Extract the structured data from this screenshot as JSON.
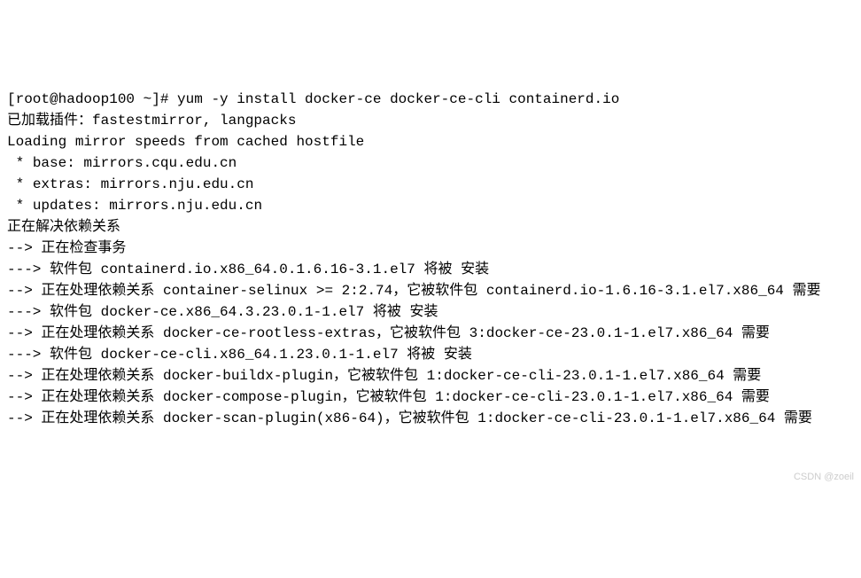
{
  "terminal": {
    "lines": [
      "[root@hadoop100 ~]# yum -y install docker-ce docker-ce-cli containerd.io",
      "已加载插件：fastestmirror, langpacks",
      "Loading mirror speeds from cached hostfile",
      " * base: mirrors.cqu.edu.cn",
      " * extras: mirrors.nju.edu.cn",
      " * updates: mirrors.nju.edu.cn",
      "正在解决依赖关系",
      "--> 正在检查事务",
      "---> 软件包 containerd.io.x86_64.0.1.6.16-3.1.el7 将被 安装",
      "--> 正在处理依赖关系 container-selinux >= 2:2.74，它被软件包 containerd.io-1.6.16-3.1.el7.x86_64 需要",
      "---> 软件包 docker-ce.x86_64.3.23.0.1-1.el7 将被 安装",
      "--> 正在处理依赖关系 docker-ce-rootless-extras，它被软件包 3:docker-ce-23.0.1-1.el7.x86_64 需要",
      "---> 软件包 docker-ce-cli.x86_64.1.23.0.1-1.el7 将被 安装",
      "--> 正在处理依赖关系 docker-buildx-plugin，它被软件包 1:docker-ce-cli-23.0.1-1.el7.x86_64 需要",
      "--> 正在处理依赖关系 docker-compose-plugin，它被软件包 1:docker-ce-cli-23.0.1-1.el7.x86_64 需要",
      "--> 正在处理依赖关系 docker-scan-plugin(x86-64)，它被软件包 1:docker-ce-cli-23.0.1-1.el7.x86_64 需要"
    ]
  },
  "watermark": "CSDN @zoeil"
}
